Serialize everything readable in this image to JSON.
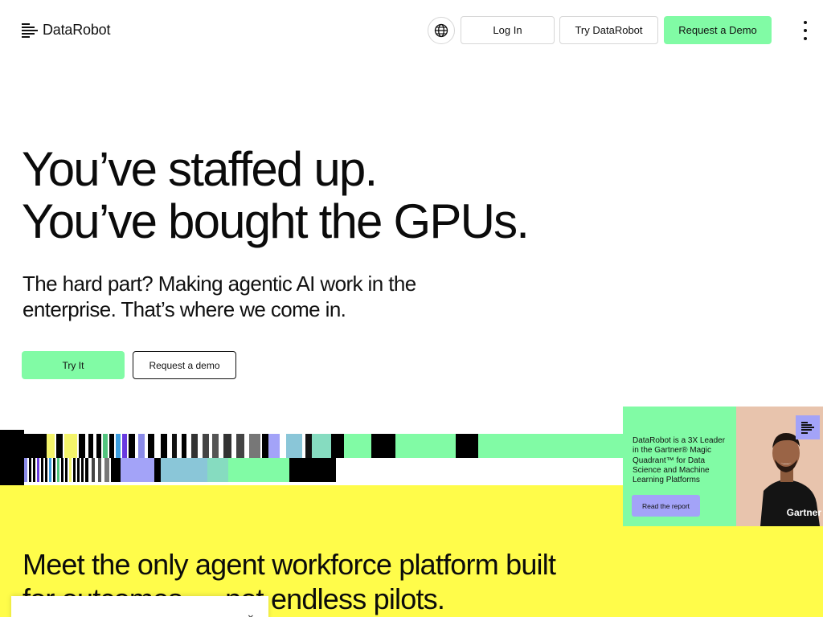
{
  "header": {
    "logo_text": "DataRobot",
    "logo_icon": "datarobot-logo-icon",
    "language_icon": "globe-icon",
    "login_label": "Log In",
    "try_label": "Try DataRobot",
    "demo_label": "Request a Demo",
    "menu_icon": "vertical-ellipsis-icon"
  },
  "hero": {
    "title_line1": "You’ve staffed up.",
    "title_line2": "You’ve bought the GPUs.",
    "subtitle": "The hard part? Making agentic AI work in the enterprise. That’s where we come in.",
    "primary_cta": "Try It",
    "secondary_cta": "Request a demo"
  },
  "gartner_card": {
    "text": "DataRobot is a 3X Leader in the Gartner® Magic Quadrant™ for Data Science and Machine Learning Platforms",
    "button_label": "Read the report",
    "brand": "Gartner"
  },
  "section": {
    "heading": "Meet the only agent workforce platform built for outcomes — not endless pilots."
  },
  "bottom_panel": {
    "collapse_icon": "chevron-down-icon"
  },
  "colors": {
    "accent_green": "#81fba5",
    "accent_yellow": "#fffc4a",
    "accent_purple": "#a3a3f8"
  }
}
